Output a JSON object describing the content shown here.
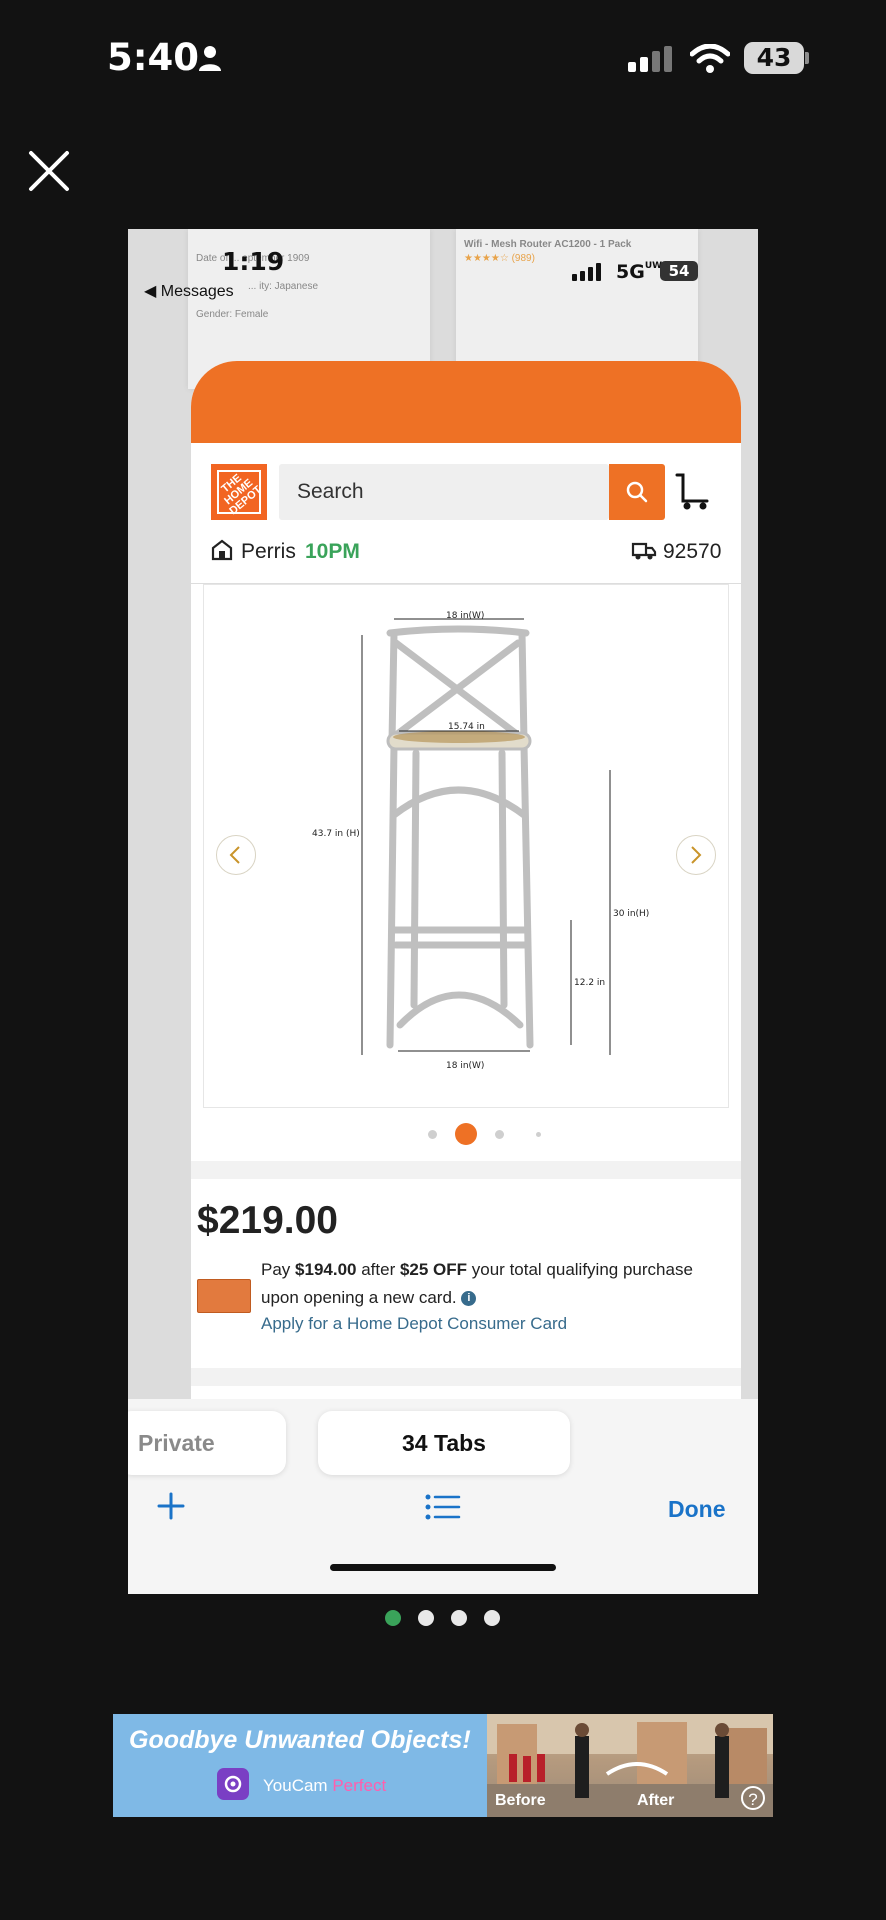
{
  "status_bar": {
    "time": "5:40",
    "battery": "43"
  },
  "inner_screenshot": {
    "status_bar": {
      "time": "1:19",
      "back_label": "◀ Messages",
      "network": "5G",
      "network_suffix": "UW",
      "battery": "54"
    },
    "background_tabs": [
      {
        "lines": [
          "Date of ... eptember 1909",
          "... ity: Japanese",
          "Gender: Female"
        ]
      },
      {
        "lines": [
          "Wifi - Mesh Router AC1200 - 1 Pack",
          "★★★★☆ (989)"
        ]
      }
    ],
    "home_depot": {
      "logo_text": "THE HOME DEPOT",
      "search_placeholder": "Search",
      "store_name": "Perris",
      "store_hours": "10PM",
      "zip": "92570",
      "product_image": {
        "dimensions": {
          "top_width": "18 in(W)",
          "seat_width": "15.74 in",
          "total_height": "43.7 in (H)",
          "seat_height": "30 in(H)",
          "footrest_height": "12.2 in",
          "bottom_width": "18 in(W)"
        },
        "carousel_index": 1,
        "carousel_count": 4
      },
      "price": "$219.00",
      "promo": {
        "prefix": "Pay ",
        "promo_price": "$194.00",
        "middle": " after ",
        "discount": "$25 OFF",
        "suffix": " your total qualifying purchase upon opening a new card.",
        "apply_link": "Apply for a Home Depot Consumer Card"
      }
    },
    "safari_bar": {
      "private_label": "Private",
      "tabs_label": "34 Tabs",
      "done_label": "Done"
    }
  },
  "page_dots": {
    "count": 4,
    "active_index": 0,
    "active_color": "#3aa35a"
  },
  "ad": {
    "headline": "Goodbye Unwanted Objects!",
    "brand_main": "YouCam",
    "brand_accent": "Perfect",
    "before_label": "Before",
    "after_label": "After",
    "help_label": "?"
  },
  "colors": {
    "brand_orange": "#ee7125",
    "link_blue": "#376b8c",
    "ios_blue": "#1a73c8"
  }
}
